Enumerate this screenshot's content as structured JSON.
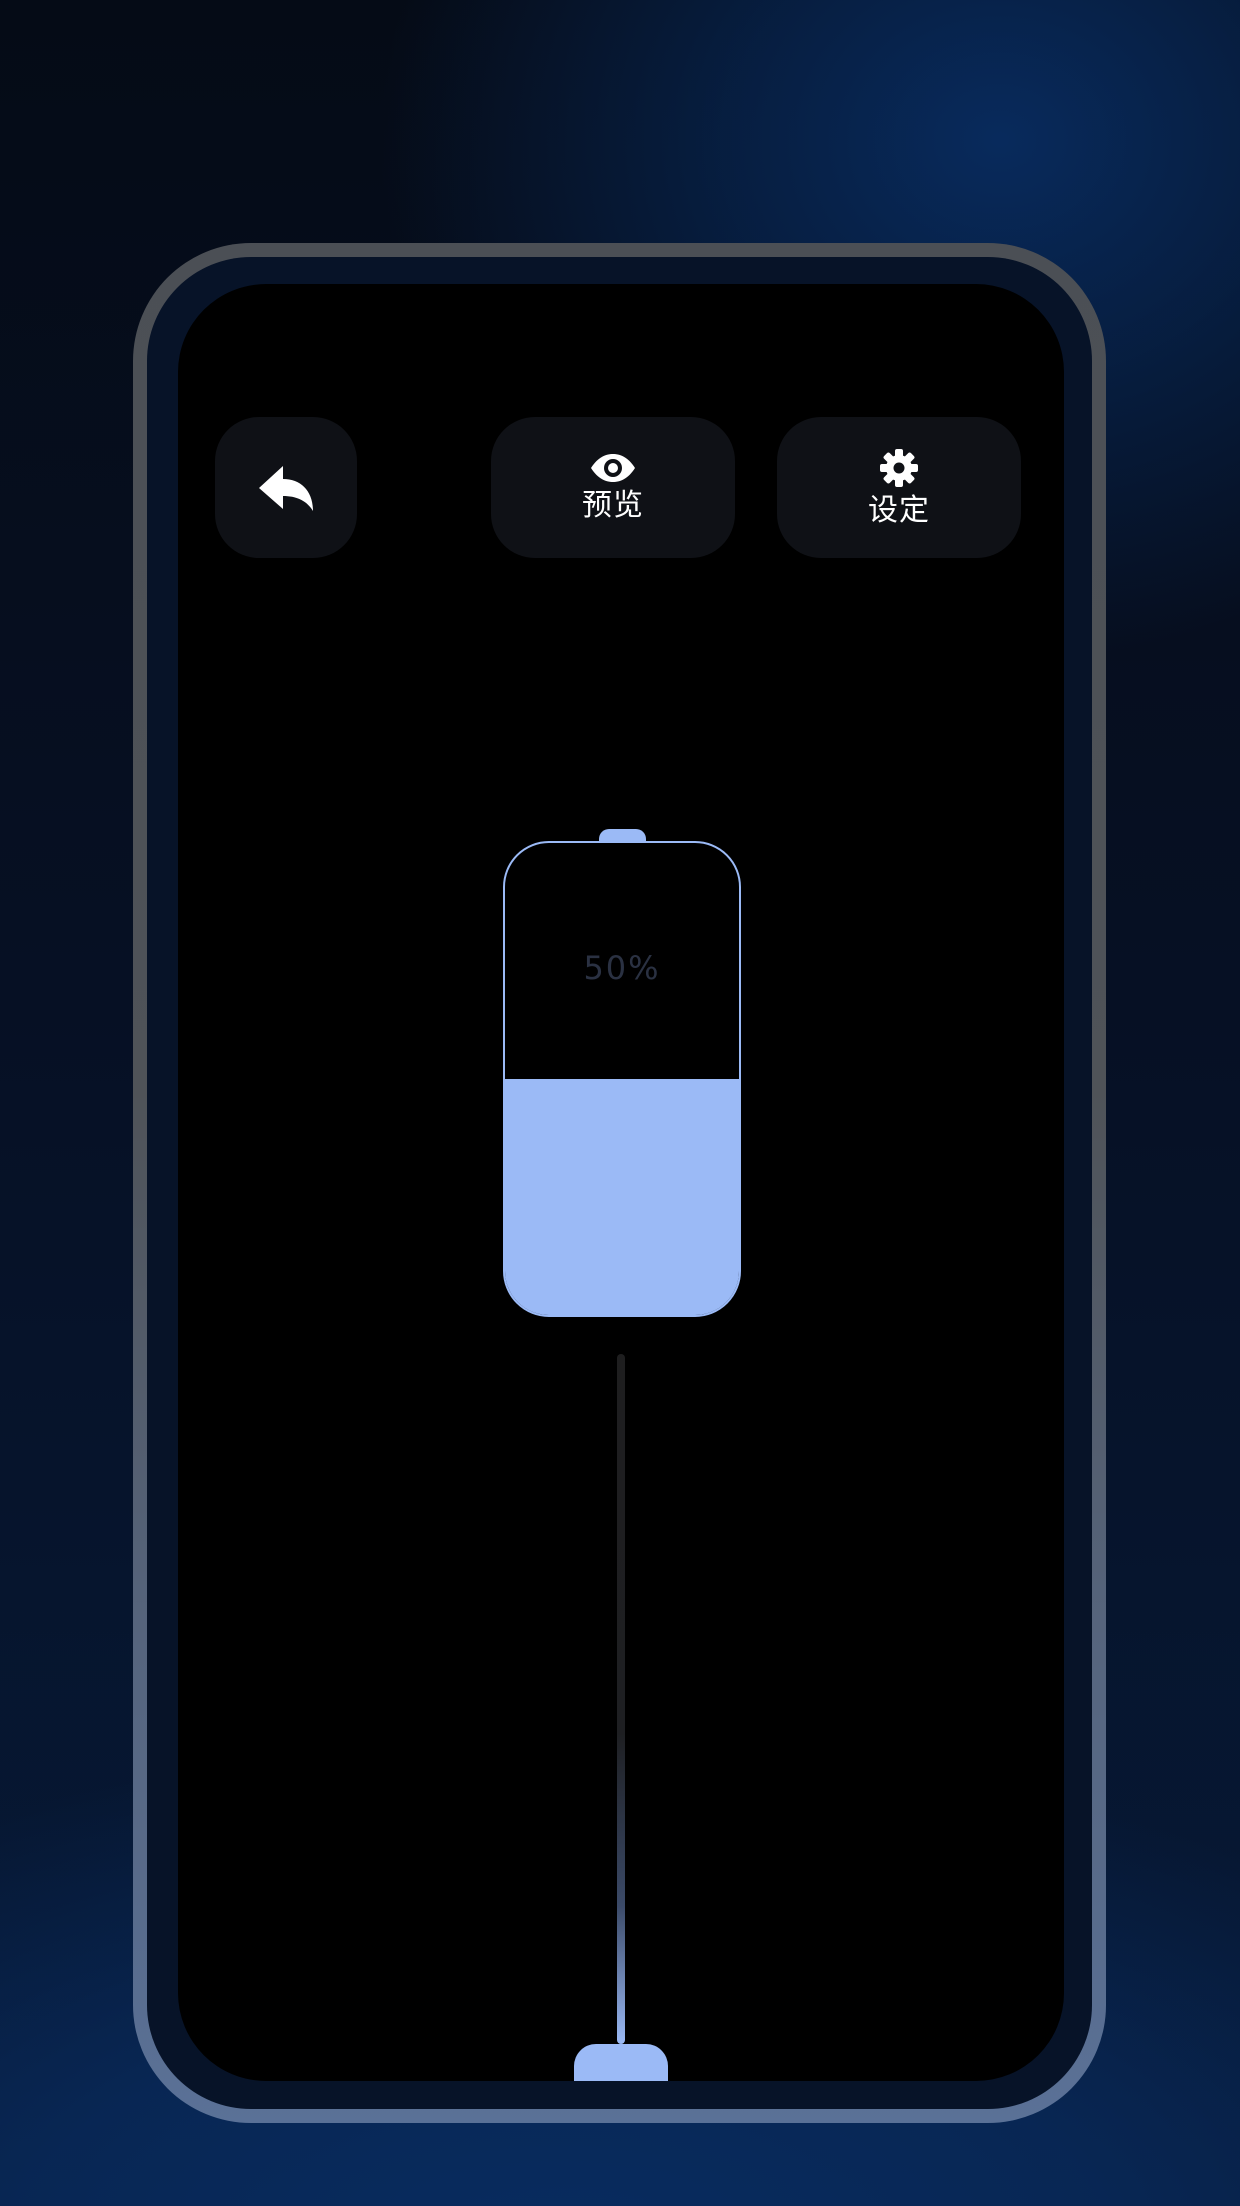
{
  "toolbar": {
    "preview_label": "预览",
    "settings_label": "设定"
  },
  "icons": {
    "back": "reply-arrow-icon",
    "preview": "eye-icon",
    "settings": "gear-icon"
  },
  "battery": {
    "level_percent": 50,
    "label": "50%"
  },
  "colors": {
    "accent": "#9bbaf6",
    "button_bg": "#0f1116",
    "screen_bg": "#000000"
  }
}
